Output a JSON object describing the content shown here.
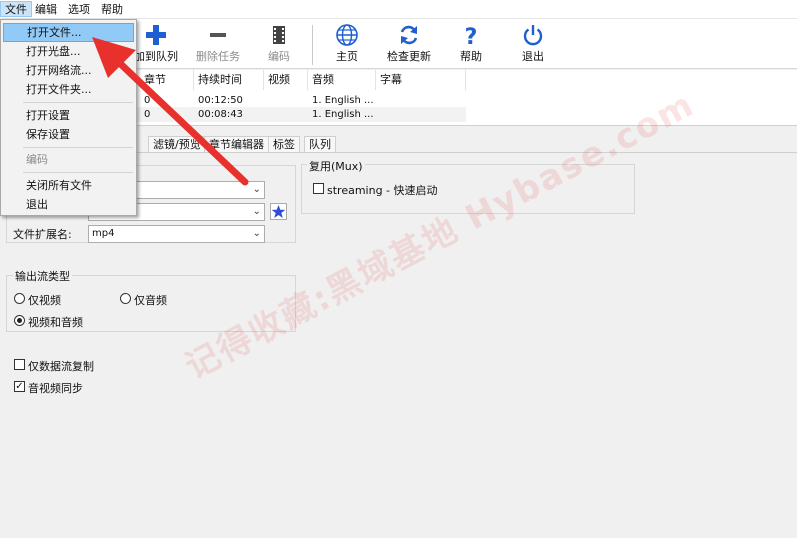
{
  "menubar": {
    "items": [
      {
        "label": "文件"
      },
      {
        "label": "编辑"
      },
      {
        "label": "选项"
      },
      {
        "label": "帮助"
      }
    ]
  },
  "toolbar": {
    "add_queue": "加到队列",
    "remove_task": "删除任务",
    "encode": "编码",
    "home": "主页",
    "check_update": "检查更新",
    "help": "帮助",
    "exit": "退出"
  },
  "table": {
    "headers": [
      "章节",
      "持续时间",
      "视频",
      "音频",
      "字幕"
    ],
    "rows": [
      {
        "chapter": "0",
        "duration": "00:12:50",
        "video": "",
        "audio": "1. English ...",
        "subtitle": ""
      },
      {
        "chapter": "0",
        "duration": "00:08:43",
        "video": "",
        "audio": "1. English ...",
        "subtitle": ""
      }
    ]
  },
  "tabs": [
    "滤镜/预览",
    "章节编辑器",
    "标签",
    "队列"
  ],
  "mux": {
    "title": "复用(Mux)",
    "streaming_label": "streaming - 快速启动"
  },
  "format": {
    "ext_label": "文件扩展名:",
    "ext_value": "mp4"
  },
  "output_stream": {
    "title": "输出流类型",
    "video_only": "仅视频",
    "audio_only": "仅音频",
    "video_audio": "视频和音频"
  },
  "options": {
    "data_copy": "仅数据流复制",
    "av_sync": "音视频同步"
  },
  "file_menu": {
    "items": [
      {
        "label": "打开文件..."
      },
      {
        "label": "打开光盘..."
      },
      {
        "label": "打开网络流..."
      },
      {
        "label": "打开文件夹..."
      },
      {
        "label": "打开设置"
      },
      {
        "label": "保存设置"
      },
      {
        "label": "编码"
      },
      {
        "label": "关闭所有文件"
      },
      {
        "label": "退出"
      }
    ]
  },
  "watermark": {
    "text": "记得收藏:黑域基地 Hybase.com"
  },
  "colors": {
    "accent_blue": "#1f5fd1",
    "arrow_red": "#e8312c",
    "menu_highlight": "#91c9f7"
  }
}
